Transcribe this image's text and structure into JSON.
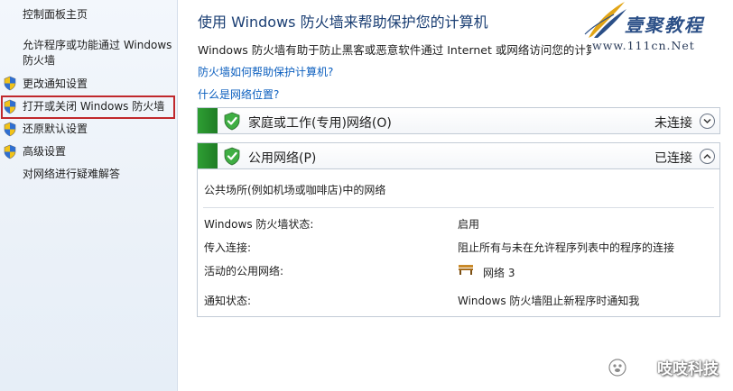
{
  "sidebar": {
    "items": [
      {
        "label": "控制面板主页",
        "shield": false
      },
      {
        "label": "允许程序或功能通过 Windows 防火墙",
        "shield": false
      },
      {
        "label": "更改通知设置",
        "shield": true
      },
      {
        "label": "打开或关闭 Windows 防火墙",
        "shield": true,
        "highlighted": true
      },
      {
        "label": "还原默认设置",
        "shield": true
      },
      {
        "label": "高级设置",
        "shield": true
      },
      {
        "label": "对网络进行疑难解答",
        "shield": false
      }
    ]
  },
  "main": {
    "title": "使用 Windows 防火墙来帮助保护您的计算机",
    "description": "Windows 防火墙有助于防止黑客或恶意软件通过 Internet 或网络访问您的计算机",
    "links": [
      {
        "label": "防火墙如何帮助保护计算机?"
      },
      {
        "label": "什么是网络位置?"
      }
    ]
  },
  "networks": [
    {
      "name": "家庭或工作(专用)网络(O)",
      "status": "未连接",
      "expanded": false
    },
    {
      "name": "公用网络(P)",
      "status": "已连接",
      "expanded": true
    }
  ],
  "public_details": {
    "description": "公共场所(例如机场或咖啡店)中的网络",
    "rows": [
      {
        "label": "Windows 防火墙状态:",
        "value": "启用"
      },
      {
        "label": "传入连接:",
        "value": "阻止所有与未在允许程序列表中的程序的连接"
      },
      {
        "label": "活动的公用网络:",
        "value": "网络  3"
      },
      {
        "label": "通知状态:",
        "value": "Windows 防火墙阻止新程序时通知我"
      }
    ]
  },
  "watermark": {
    "logo_text": "壹聚教程",
    "logo_url": "www.111cn.Net",
    "bottom_text": "吱吱科技"
  },
  "colors": {
    "accent_green": "#2e9e33",
    "title_blue": "#1a3e73",
    "link_blue": "#0c5fbf",
    "highlight_red": "#c0282c"
  },
  "icons": {
    "shield": "uac-shield-icon",
    "net_shield": "green-check-shield-icon",
    "chevron_down": "chevron-down-icon",
    "chevron_up": "chevron-up-icon",
    "bench": "public-network-bench-icon"
  }
}
